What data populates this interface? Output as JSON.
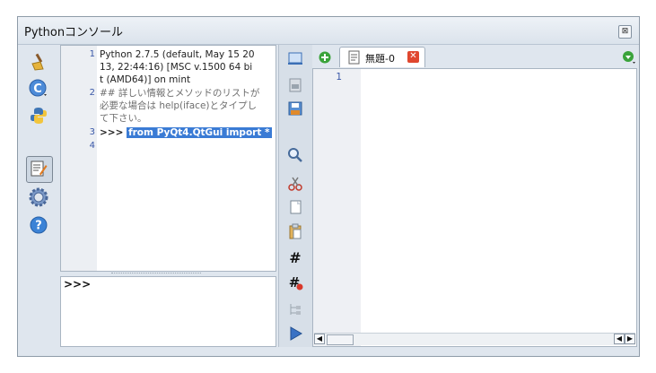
{
  "window": {
    "title": "Pythonコンソール",
    "close_glyph": "⊠"
  },
  "left_toolbar": {
    "icons": [
      "clear-broom-icon",
      "run-c-icon",
      "python-icon",
      "editor-toggle-icon",
      "settings-gear-icon",
      "help-icon"
    ]
  },
  "output": {
    "lines": [
      {
        "num": "1",
        "text": "Python 2.7.5 (default, May 15 20"
      },
      {
        "num": "",
        "text": "13, 22:44:16) [MSC v.1500 64 bi"
      },
      {
        "num": "",
        "text": "t (AMD64)] on mint"
      },
      {
        "num": "2",
        "text": "## 詳しい情報とメソッドのリストが"
      },
      {
        "num": "",
        "text": "必要な場合は help(iface)とタイプし"
      },
      {
        "num": "",
        "text": "て下さい。"
      },
      {
        "num": "3",
        "prompt": ">>>",
        "highlight": "from PyQt4.QtGui import *"
      },
      {
        "num": "4",
        "text": ""
      }
    ]
  },
  "input": {
    "prompt": ">>>"
  },
  "editor_toolbar": {
    "icons": [
      "console-icon",
      "open-file-icon",
      "save-icon",
      "find-icon",
      "cut-icon",
      "copy-icon",
      "paste-icon",
      "comment-icon",
      "uncomment-icon",
      "object-inspector-icon",
      "run-script-icon"
    ]
  },
  "editor": {
    "add_tab_icon": "add-tab-icon",
    "tab_label": "無題-0",
    "tab_close_glyph": "✕",
    "line_numbers": [
      "1"
    ],
    "scroll_left": "◀",
    "scroll_right": "▶"
  },
  "colors": {
    "highlight": "#3a7bd5",
    "number": "#2a7a2a",
    "line_number": "#3a58a8"
  }
}
